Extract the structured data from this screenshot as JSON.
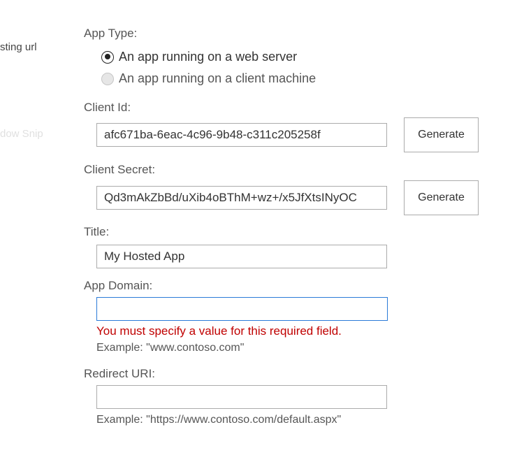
{
  "left_panel": {
    "hosting_url_fragment": "sting url",
    "faded_fragment": "dow Snip"
  },
  "app_type": {
    "label": "App Type:",
    "options": [
      {
        "label": "An app running on a web server",
        "selected": true,
        "enabled": true
      },
      {
        "label": "An app running on a client machine",
        "selected": false,
        "enabled": false
      }
    ]
  },
  "client_id": {
    "label": "Client Id:",
    "value": "afc671ba-6eac-4c96-9b48-c311c205258f",
    "generate_label": "Generate"
  },
  "client_secret": {
    "label": "Client Secret:",
    "value": "Qd3mAkZbBd/uXib4oBThM+wz+/x5JfXtsINyOC",
    "generate_label": "Generate"
  },
  "title": {
    "label": "Title:",
    "value": "My Hosted App"
  },
  "app_domain": {
    "label": "App Domain:",
    "value": "",
    "error": "You must specify a value for this required field.",
    "example": "Example: \"www.contoso.com\""
  },
  "redirect_uri": {
    "label": "Redirect URI:",
    "value": "",
    "example": "Example: \"https://www.contoso.com/default.aspx\""
  },
  "colors": {
    "error_text": "#c00000",
    "focus_border": "#2b7bd8",
    "field_border": "#ababab"
  }
}
